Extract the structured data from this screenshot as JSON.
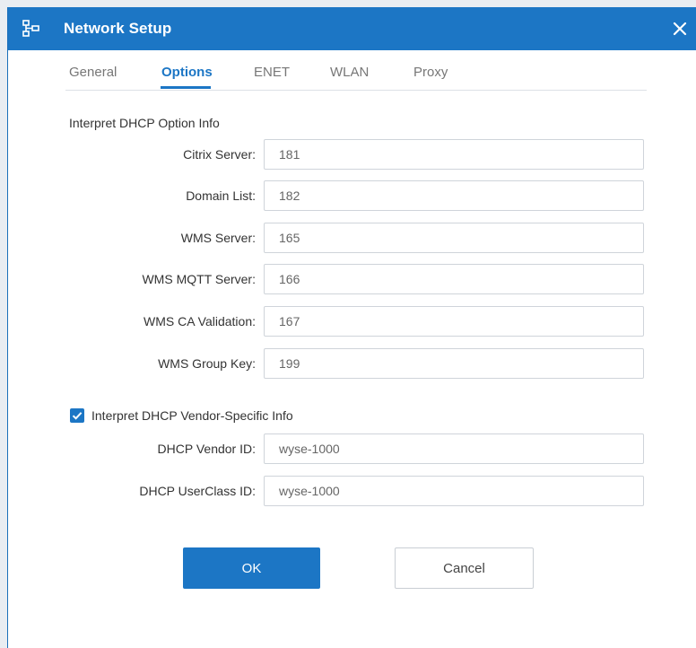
{
  "window": {
    "title": "Network Setup",
    "icon": "network-icon",
    "close_icon": "close-icon"
  },
  "tabs": [
    {
      "label": "General",
      "active": false
    },
    {
      "label": "Options",
      "active": true
    },
    {
      "label": "ENET",
      "active": false
    },
    {
      "label": "WLAN",
      "active": false
    },
    {
      "label": "Proxy",
      "active": false
    }
  ],
  "dhcp_options": {
    "section_label": "Interpret DHCP Option Info",
    "fields": [
      {
        "label": "Citrix Server:",
        "value": "181"
      },
      {
        "label": "Domain List:",
        "value": "182"
      },
      {
        "label": "WMS Server:",
        "value": "165"
      },
      {
        "label": "WMS MQTT Server:",
        "value": "166"
      },
      {
        "label": "WMS CA Validation:",
        "value": "167"
      },
      {
        "label": "WMS Group Key:",
        "value": "199"
      }
    ]
  },
  "vendor_specific": {
    "checkbox_label": "Interpret DHCP Vendor-Specific Info",
    "checked": true,
    "fields": [
      {
        "label": "DHCP Vendor ID:",
        "value": "wyse-1000"
      },
      {
        "label": "DHCP UserClass ID:",
        "value": "wyse-1000"
      }
    ]
  },
  "buttons": {
    "ok_label": "OK",
    "cancel_label": "Cancel"
  },
  "colors": {
    "accent": "#1c76c5",
    "title_text": "#ffffff",
    "border": "#cfd4da"
  }
}
